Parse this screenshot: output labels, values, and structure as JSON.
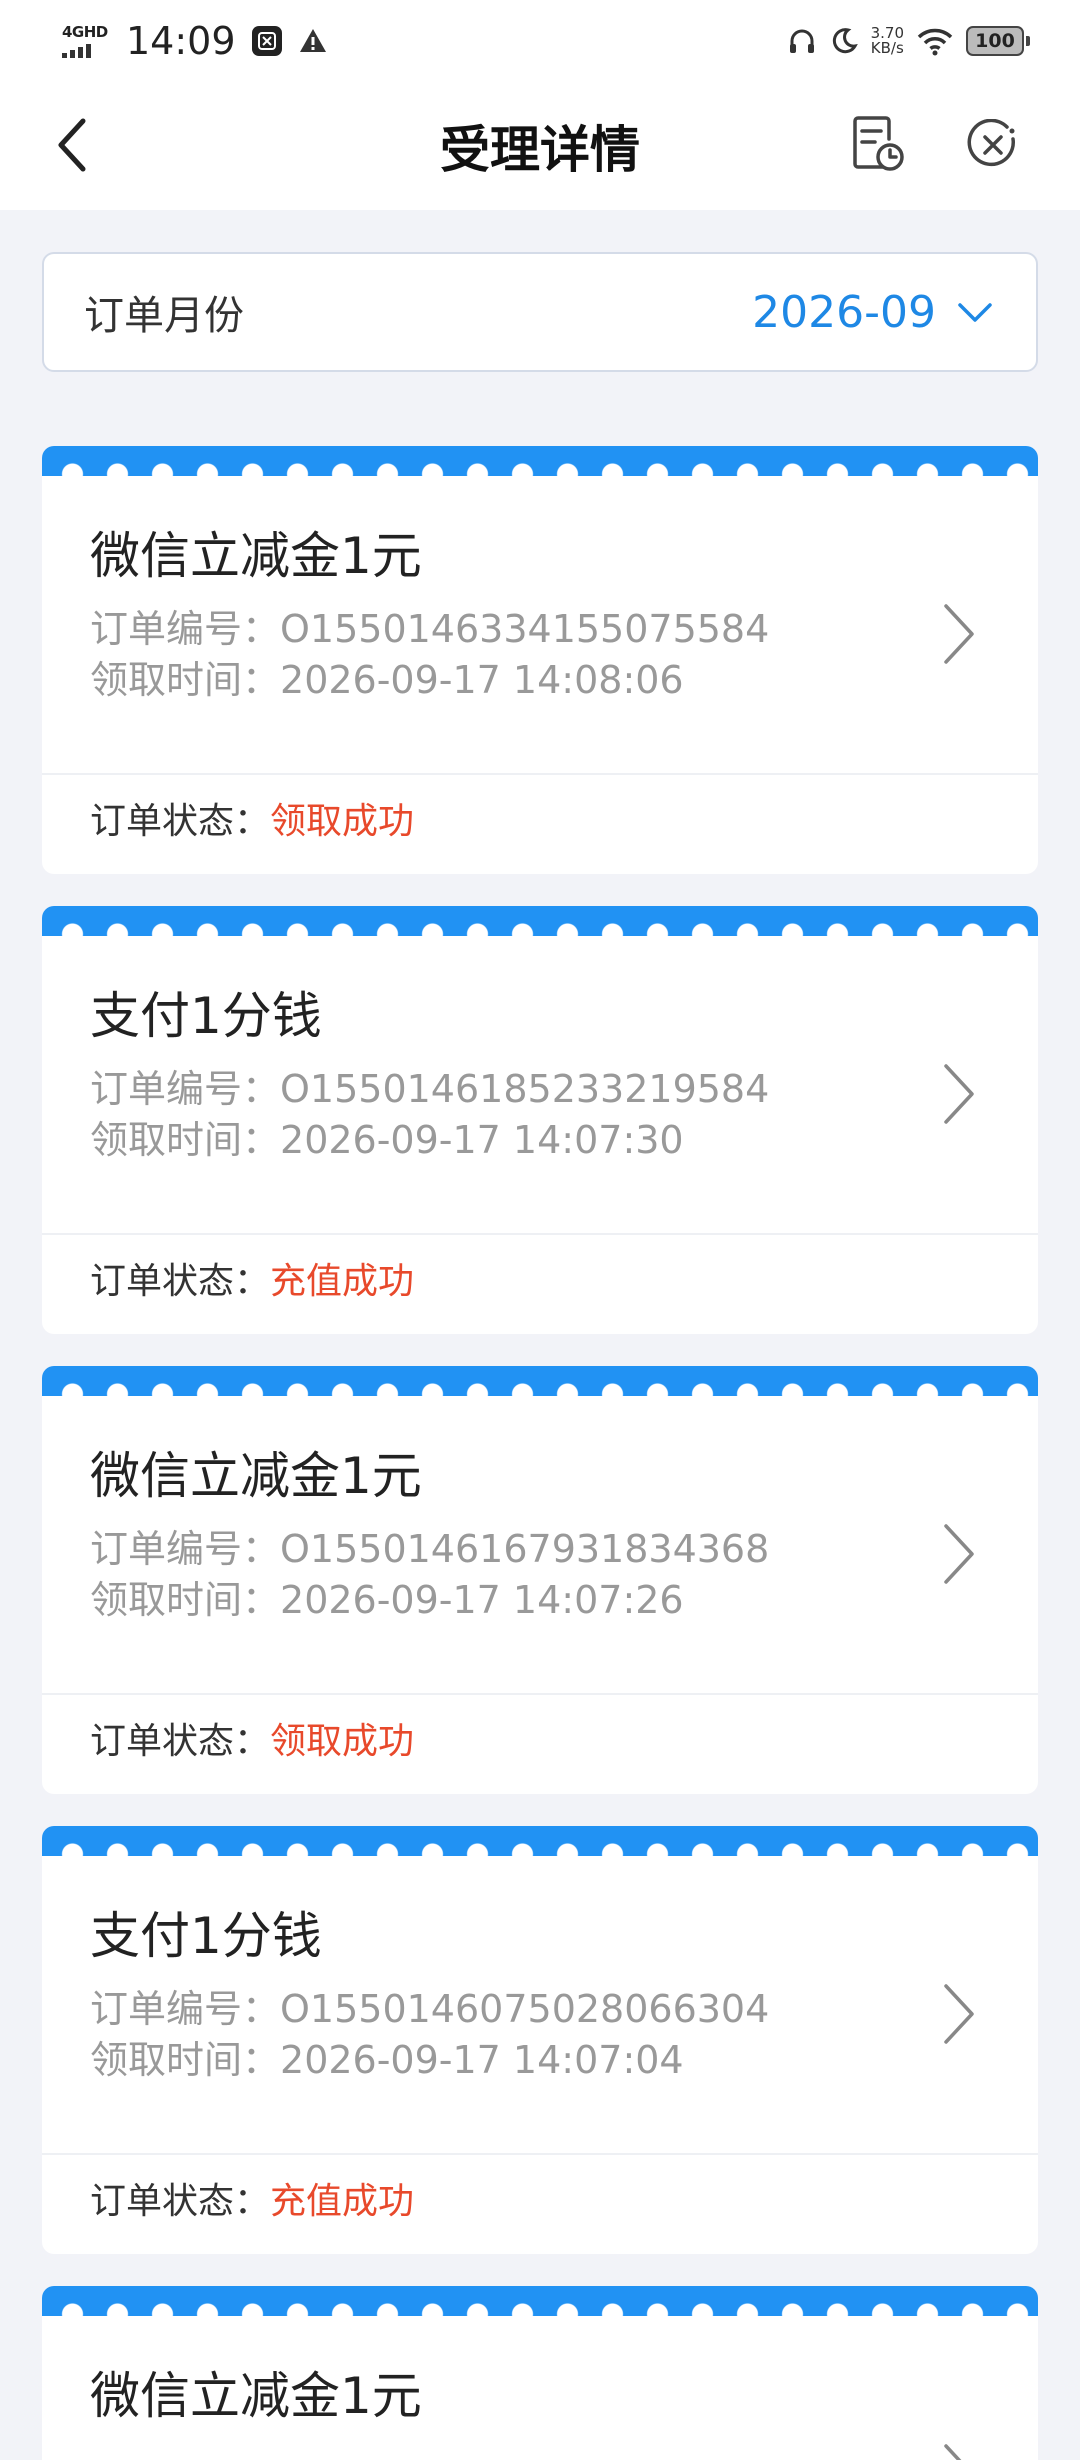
{
  "status_bar": {
    "network": "4GHD",
    "time": "14:09",
    "speed_value": "3.70",
    "speed_unit": "KB/s",
    "battery": "100"
  },
  "nav": {
    "title": "受理详情"
  },
  "filter": {
    "label": "订单月份",
    "value": "2026-09"
  },
  "labels": {
    "order_no": "订单编号：",
    "receive_time": "领取时间：",
    "order_status": "订单状态："
  },
  "orders": [
    {
      "title": "微信立减金1元",
      "order_no": "O1550146334155075584",
      "time": "2026-09-17 14:08:06",
      "status": "领取成功"
    },
    {
      "title": "支付1分钱",
      "order_no": "O1550146185233219584",
      "time": "2026-09-17 14:07:30",
      "status": "充值成功"
    },
    {
      "title": "微信立减金1元",
      "order_no": "O1550146167931834368",
      "time": "2026-09-17 14:07:26",
      "status": "领取成功"
    },
    {
      "title": "支付1分钱",
      "order_no": "O1550146075028066304",
      "time": "2026-09-17 14:07:04",
      "status": "充值成功"
    },
    {
      "title": "微信立减金1元"
    }
  ],
  "colors": {
    "accent": "#1e88e5",
    "card_header": "#2192f3",
    "status_text": "#e8492b",
    "page_bg": "#f2f3f8"
  },
  "icons": {
    "back": "chevron-left-icon",
    "history": "document-clock-icon",
    "close": "close-circle-icon",
    "dropdown": "chevron-down-icon",
    "card_arrow": "chevron-right-icon"
  }
}
